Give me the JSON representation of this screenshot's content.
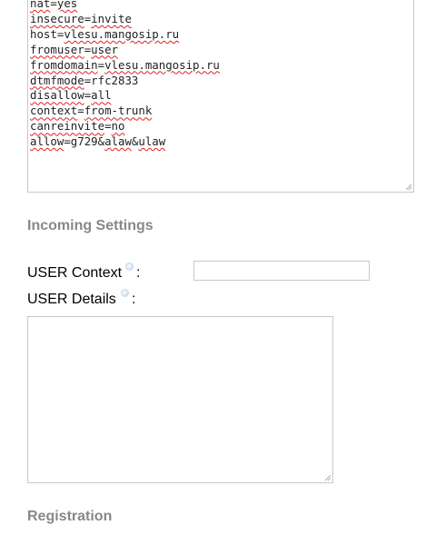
{
  "peer_details": {
    "lines": [
      [
        {
          "t": "",
          "s": true
        },
        {
          "t": "nat",
          "s": true
        },
        {
          "t": "=",
          "s": false
        },
        {
          "t": "yes",
          "s": true
        }
      ],
      [
        {
          "t": "insecure",
          "s": true
        },
        {
          "t": "=",
          "s": false
        },
        {
          "t": "invite",
          "s": true
        }
      ],
      [
        {
          "t": "host",
          "s": false
        },
        {
          "t": "=",
          "s": false
        },
        {
          "t": "vlesu.mangosip.ru",
          "s": true
        }
      ],
      [
        {
          "t": "fromuser",
          "s": true
        },
        {
          "t": "=",
          "s": false
        },
        {
          "t": "user",
          "s": true
        }
      ],
      [
        {
          "t": "fromdomain",
          "s": true
        },
        {
          "t": "=",
          "s": false
        },
        {
          "t": "vlesu.mangosip.ru",
          "s": true
        }
      ],
      [
        {
          "t": "dtmfmode",
          "s": true
        },
        {
          "t": "=rfc2833",
          "s": false
        }
      ],
      [
        {
          "t": "disallow",
          "s": true
        },
        {
          "t": "=",
          "s": false
        },
        {
          "t": "all",
          "s": true
        }
      ],
      [
        {
          "t": "context",
          "s": true
        },
        {
          "t": "=",
          "s": false
        },
        {
          "t": "from-trunk",
          "s": true
        }
      ],
      [
        {
          "t": "canreinvite",
          "s": true
        },
        {
          "t": "=",
          "s": false
        },
        {
          "t": "no",
          "s": true
        }
      ],
      [
        {
          "t": "allow",
          "s": true
        },
        {
          "t": "=g729&",
          "s": false
        },
        {
          "t": "alaw",
          "s": true
        },
        {
          "t": "&",
          "s": false
        },
        {
          "t": "ulaw",
          "s": true
        }
      ]
    ]
  },
  "incoming": {
    "heading": "Incoming Settings",
    "user_context_label": "USER Context",
    "user_context_value": "",
    "user_details_label": "USER Details",
    "user_details_value": "",
    "colon": ":"
  },
  "registration": {
    "heading": "Registration"
  },
  "colors": {
    "heading": "#888888",
    "border": "#c8c8c8",
    "spellcheck": "#e02020"
  }
}
